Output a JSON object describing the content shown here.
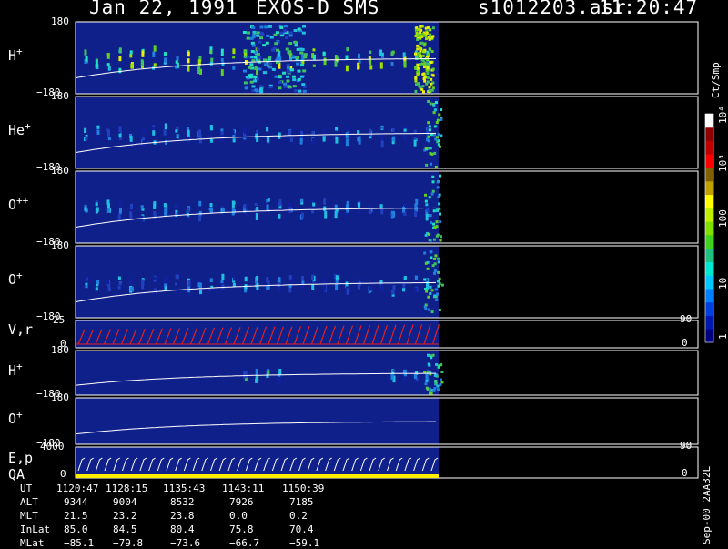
{
  "header": {
    "date": "Jan 22, 1991",
    "mission": "EXOS-D SMS",
    "file": "s1012203.asr",
    "time": "11:20:47"
  },
  "colors": {
    "panel_bg": "#10208a",
    "vr_line": "#e02020",
    "qa_bar": "#ffee00",
    "trace": "#ffffff"
  },
  "chart_data": {
    "type": "heatmap",
    "panels": [
      {
        "label": "H",
        "sup": "+",
        "ymax": "180",
        "ymin": "−180",
        "intensity": "high",
        "burst_start": 0.46,
        "burst_end": 0.63
      },
      {
        "label": "He",
        "sup": "+",
        "ymax": "180",
        "ymin": "−180",
        "intensity": "low"
      },
      {
        "label": "O",
        "sup": "++",
        "ymax": "180",
        "ymin": "−180",
        "intensity": "low"
      },
      {
        "label": "O",
        "sup": "+",
        "ymax": "180",
        "ymin": "−180",
        "intensity": "low"
      },
      {
        "label": "V,r",
        "sup": "",
        "ymax": "25",
        "ymin": "0",
        "right_top": "90",
        "right_bottom": "0"
      },
      {
        "label": "H",
        "sup": "+",
        "ymax": "180",
        "ymin": "−180",
        "intensity": "sparse"
      },
      {
        "label": "O",
        "sup": "+",
        "ymax": "180",
        "ymin": "−180",
        "intensity": "none"
      },
      {
        "label": "E,p",
        "label2": "QA",
        "sup": "",
        "ymax": "4000",
        "ymin": "0",
        "right_top": "90",
        "right_bottom": "0"
      }
    ],
    "colorbar": {
      "title": "Ct/Smp",
      "ticks": [
        "1",
        "10",
        "100",
        "10³",
        "10⁴"
      ],
      "colors": [
        "#000080",
        "#0018b0",
        "#0040e0",
        "#0080ff",
        "#00c8ff",
        "#00e8d0",
        "#20c080",
        "#40d020",
        "#80e000",
        "#c0f000",
        "#ffff00",
        "#c0a000",
        "#806000",
        "#ff0000",
        "#c00000",
        "#900000",
        "#ffffff"
      ]
    },
    "ephemeris": {
      "rows": [
        "UT",
        "ALT",
        "MLT",
        "InLat",
        "MLat"
      ],
      "columns": [
        [
          "1120:47",
          "9344",
          "21.5",
          "85.0",
          "−85.1"
        ],
        [
          "1128:15",
          "9004",
          "23.2",
          "84.5",
          "−79.8"
        ],
        [
          "1135:43",
          "8532",
          "23.8",
          "80.4",
          "−73.6"
        ],
        [
          "1143:11",
          "7926",
          "0.0",
          "75.8",
          "−66.7"
        ],
        [
          "1150:39",
          "7185",
          "0.2",
          "70.4",
          "−59.1"
        ]
      ]
    },
    "footer": "Sep-00  2AA32L"
  }
}
